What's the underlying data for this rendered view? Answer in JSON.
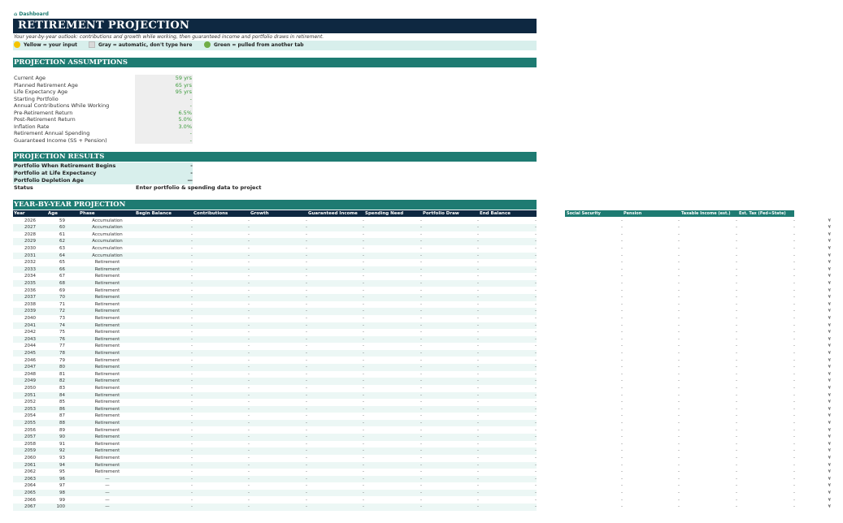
{
  "dashboard_link": "⌂ Dashboard",
  "title": "RETIREMENT PROJECTION",
  "subtitle": "Your year-by-year outlook: contributions and growth while working, then guaranteed income and portfolio draws in retirement.",
  "legend": {
    "input": "Yellow = your input",
    "auto": "Gray = automatic, don't type here",
    "linked": "Green = pulled from another tab"
  },
  "assumptions": {
    "header": "PROJECTION ASSUMPTIONS",
    "rows": [
      {
        "label": "Current Age",
        "value": "59 yrs"
      },
      {
        "label": "Planned Retirement Age",
        "value": "65 yrs"
      },
      {
        "label": "Life Expectancy Age",
        "value": "95 yrs"
      },
      {
        "label": "Starting Portfolio",
        "value": "-"
      },
      {
        "label": "Annual Contributions While Working",
        "value": "-"
      },
      {
        "label": "Pre-Retirement Return",
        "value": "6.5%"
      },
      {
        "label": "Post-Retirement Return",
        "value": "5.0%"
      },
      {
        "label": "Inflation Rate",
        "value": "3.0%"
      },
      {
        "label": "Retirement Annual Spending",
        "value": "-"
      },
      {
        "label": "Guaranteed Income (SS + Pension)",
        "value": "-"
      }
    ]
  },
  "results": {
    "header": "PROJECTION RESULTS",
    "rows": [
      {
        "label": "Portfolio When Retirement Begins",
        "value": "-"
      },
      {
        "label": "Portfolio at Life Expectancy",
        "value": "-"
      },
      {
        "label": "Portfolio Depletion Age",
        "value": "—"
      },
      {
        "label": "Status",
        "value": ""
      }
    ],
    "status_message": "Enter portfolio & spending data to project"
  },
  "projection": {
    "header": "YEAR-BY-YEAR PROJECTION",
    "columns": [
      "Year",
      "Age",
      "Phase",
      "Begin Balance",
      "Contributions",
      "Growth",
      "Guaranteed Income",
      "Spending Need",
      "Portfolio Draw",
      "End Balance"
    ],
    "side_columns": [
      "Social Security",
      "Pension",
      "Taxable Income (est.)",
      "Est. Tax (Fed+State)"
    ],
    "dash": "-",
    "flag": "¥",
    "rows": [
      {
        "year": "2026",
        "age": "59",
        "phase": "Accumulation"
      },
      {
        "year": "2027",
        "age": "60",
        "phase": "Accumulation"
      },
      {
        "year": "2028",
        "age": "61",
        "phase": "Accumulation"
      },
      {
        "year": "2029",
        "age": "62",
        "phase": "Accumulation"
      },
      {
        "year": "2030",
        "age": "63",
        "phase": "Accumulation"
      },
      {
        "year": "2031",
        "age": "64",
        "phase": "Accumulation"
      },
      {
        "year": "2032",
        "age": "65",
        "phase": "Retirement"
      },
      {
        "year": "2033",
        "age": "66",
        "phase": "Retirement"
      },
      {
        "year": "2034",
        "age": "67",
        "phase": "Retirement"
      },
      {
        "year": "2035",
        "age": "68",
        "phase": "Retirement"
      },
      {
        "year": "2036",
        "age": "69",
        "phase": "Retirement"
      },
      {
        "year": "2037",
        "age": "70",
        "phase": "Retirement"
      },
      {
        "year": "2038",
        "age": "71",
        "phase": "Retirement"
      },
      {
        "year": "2039",
        "age": "72",
        "phase": "Retirement"
      },
      {
        "year": "2040",
        "age": "73",
        "phase": "Retirement"
      },
      {
        "year": "2041",
        "age": "74",
        "phase": "Retirement"
      },
      {
        "year": "2042",
        "age": "75",
        "phase": "Retirement"
      },
      {
        "year": "2043",
        "age": "76",
        "phase": "Retirement"
      },
      {
        "year": "2044",
        "age": "77",
        "phase": "Retirement"
      },
      {
        "year": "2045",
        "age": "78",
        "phase": "Retirement"
      },
      {
        "year": "2046",
        "age": "79",
        "phase": "Retirement"
      },
      {
        "year": "2047",
        "age": "80",
        "phase": "Retirement"
      },
      {
        "year": "2048",
        "age": "81",
        "phase": "Retirement"
      },
      {
        "year": "2049",
        "age": "82",
        "phase": "Retirement"
      },
      {
        "year": "2050",
        "age": "83",
        "phase": "Retirement"
      },
      {
        "year": "2051",
        "age": "84",
        "phase": "Retirement"
      },
      {
        "year": "2052",
        "age": "85",
        "phase": "Retirement"
      },
      {
        "year": "2053",
        "age": "86",
        "phase": "Retirement"
      },
      {
        "year": "2054",
        "age": "87",
        "phase": "Retirement"
      },
      {
        "year": "2055",
        "age": "88",
        "phase": "Retirement"
      },
      {
        "year": "2056",
        "age": "89",
        "phase": "Retirement"
      },
      {
        "year": "2057",
        "age": "90",
        "phase": "Retirement"
      },
      {
        "year": "2058",
        "age": "91",
        "phase": "Retirement"
      },
      {
        "year": "2059",
        "age": "92",
        "phase": "Retirement"
      },
      {
        "year": "2060",
        "age": "93",
        "phase": "Retirement"
      },
      {
        "year": "2061",
        "age": "94",
        "phase": "Retirement"
      },
      {
        "year": "2062",
        "age": "95",
        "phase": "Retirement"
      },
      {
        "year": "2063",
        "age": "96",
        "phase": "—"
      },
      {
        "year": "2064",
        "age": "97",
        "phase": "—"
      },
      {
        "year": "2065",
        "age": "98",
        "phase": "—"
      },
      {
        "year": "2066",
        "age": "99",
        "phase": "—"
      },
      {
        "year": "2067",
        "age": "100",
        "phase": "—"
      }
    ]
  }
}
